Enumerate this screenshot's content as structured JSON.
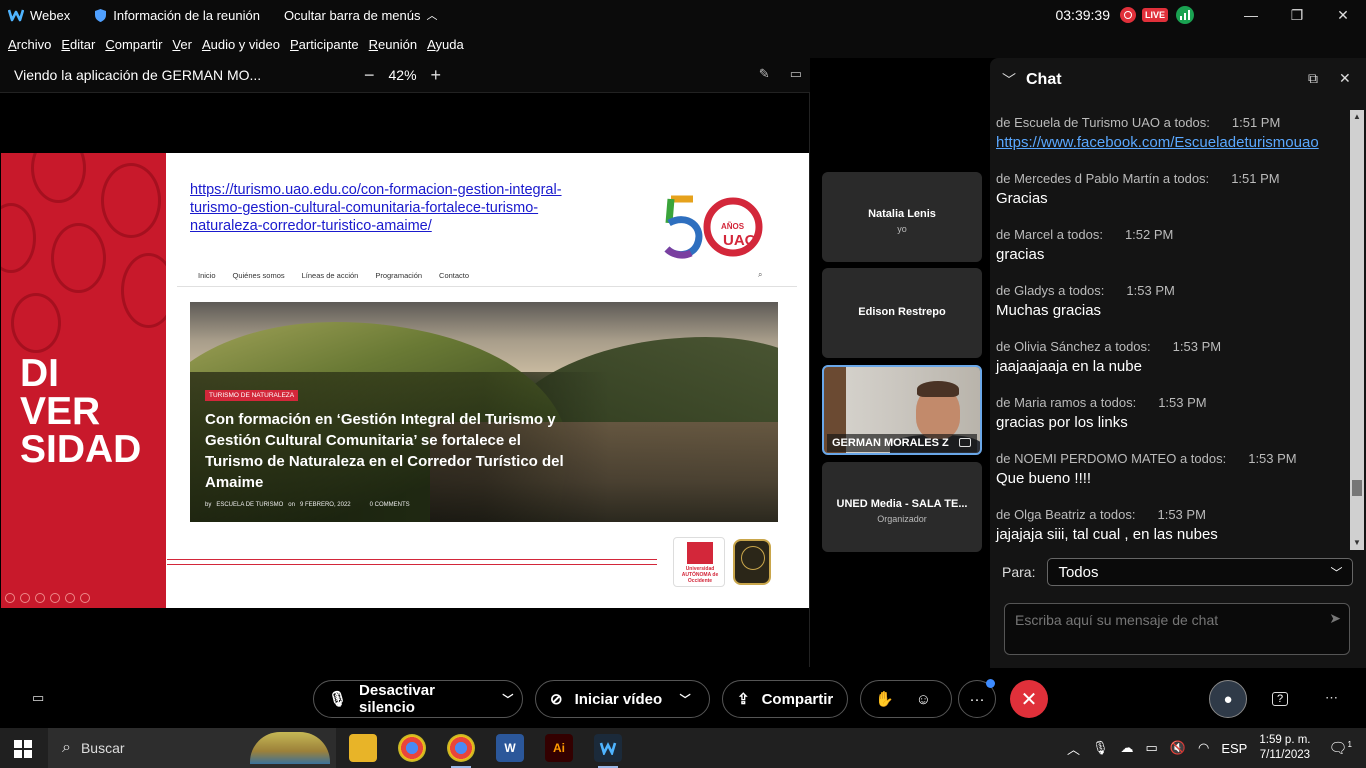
{
  "titlebar": {
    "app_name": "Webex",
    "meeting_info": "Información de la reunión",
    "hide_menu": "Ocultar barra de menús",
    "clock": "03:39:39",
    "live_badge": "LIVE",
    "minimize": "—",
    "restore": "❐",
    "close": "✕"
  },
  "menu": [
    "Archivo",
    "Editar",
    "Compartir",
    "Ver",
    "Audio y video",
    "Participante",
    "Reunión",
    "Ayuda"
  ],
  "share_header": {
    "title": "Viendo la aplicación de GERMAN MO...",
    "zoom_out": "−",
    "zoom": "42%",
    "zoom_in": "+"
  },
  "slide": {
    "side_text_lines": [
      "DI",
      "VER",
      "SIDAD"
    ],
    "url_lines": [
      "https://turismo.uao.edu.co/con-formacion-gestion-integral-",
      "turismo-gestion-cultural-comunitaria-fortalece-turismo-",
      "naturaleza-corredor-turistico-amaime/"
    ],
    "logo_years": "50",
    "logo_anos": "AÑOS",
    "logo_uao": "UAO",
    "site_nav": [
      "Inicio",
      "Quiénes somos",
      "Líneas de acción",
      "Programación",
      "Contacto"
    ],
    "tag": "TURISMO DE NATURALEZA",
    "headline": "Con formación en ‘Gestión Integral del Turismo y Gestión Cultural Comunitaria’ se fortalece el Turismo de Naturaleza en el Corredor Turístico del Amaime",
    "byline_by": "by",
    "byline_author": "ESCUELA DE TURISMO",
    "byline_on": "on",
    "byline_date": "9 FEBRERO, 2022",
    "byline_comments": "0 COMMENTS",
    "uao_logo_text": "Universidad AUTÓNOMA de Occidente"
  },
  "participants": [
    {
      "name": "Natalia Lenis",
      "sub": "yo"
    },
    {
      "name": "Edison Restrepo",
      "sub": ""
    },
    {
      "name": "GERMAN MORALES Z",
      "sub": ""
    },
    {
      "name": "UNED Media - SALA TE...",
      "sub": "Organizador"
    }
  ],
  "chat": {
    "title": "Chat",
    "messages": [
      {
        "from": "de Escuela de Turismo UAO a todos:",
        "time": "1:51 PM",
        "text": "https://www.facebook.com/Escueladeturismouao"
      },
      {
        "from": "de Mercedes d Pablo Martín a todos:",
        "time": "1:51 PM",
        "text": "Gracias"
      },
      {
        "from": "de Marcel a todos:",
        "time": "1:52 PM",
        "text": "gracias"
      },
      {
        "from": "de Gladys a todos:",
        "time": "1:53 PM",
        "text": "Muchas gracias"
      },
      {
        "from": "de Olivia Sánchez a todos:",
        "time": "1:53 PM",
        "text": "jaajaajaaja en la nube"
      },
      {
        "from": "de Maria ramos a todos:",
        "time": "1:53 PM",
        "text": "gracias por los links"
      },
      {
        "from": "de NOEMI PERDOMO MATEO a todos:",
        "time": "1:53 PM",
        "text": "Que bueno !!!!"
      },
      {
        "from": "de Olga Beatriz a todos:",
        "time": "1:53 PM",
        "text": "jajajaja siii, tal cual , en las nubes"
      }
    ],
    "to_label": "Para:",
    "to_value": "Todos",
    "input_placeholder": "Escriba aquí su mensaje de chat"
  },
  "controls": {
    "mute": "Desactivar silencio",
    "video": "Iniciar vídeo",
    "share": "Compartir",
    "more": "···",
    "end": "✕",
    "help": "?"
  },
  "taskbar": {
    "search": "Buscar",
    "lang": "ESP",
    "time": "1:59 p. m.",
    "date": "7/11/2023",
    "notif_count": "1"
  },
  "colors": {
    "accent_red": "#e0303a",
    "slide_red": "#c8192b",
    "link_blue": "#5aa8ff",
    "active_tile_border": "#6aa7e8"
  }
}
